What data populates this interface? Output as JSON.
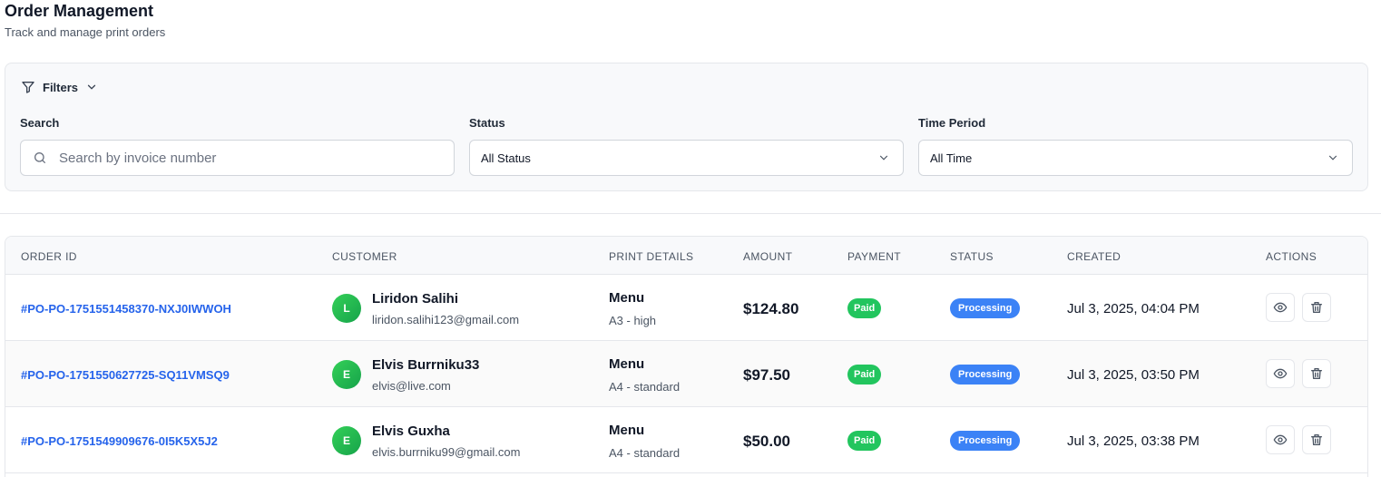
{
  "header": {
    "title": "Order Management",
    "subtitle": "Track and manage print orders"
  },
  "filters": {
    "toggle_label": "Filters",
    "search": {
      "label": "Search",
      "placeholder": "Search by invoice number",
      "value": ""
    },
    "status": {
      "label": "Status",
      "selected": "All Status"
    },
    "time_period": {
      "label": "Time Period",
      "selected": "All Time"
    }
  },
  "table": {
    "columns": [
      "Order ID",
      "Customer",
      "Print Details",
      "Amount",
      "Payment",
      "Status",
      "Created",
      "Actions"
    ],
    "rows": [
      {
        "order_id": "#PO-PO-1751551458370-NXJ0IWWOH",
        "avatar": "L",
        "customer_name": "Liridon Salihi",
        "customer_email": "liridon.salihi123@gmail.com",
        "item": "Menu",
        "spec": "A3 - high",
        "amount": "$124.80",
        "payment": "Paid",
        "status": "Processing",
        "created": "Jul 3, 2025, 04:04 PM"
      },
      {
        "order_id": "#PO-PO-1751550627725-SQ11VMSQ9",
        "avatar": "E",
        "customer_name": "Elvis Burrniku33",
        "customer_email": "elvis@live.com",
        "item": "Menu",
        "spec": "A4 - standard",
        "amount": "$97.50",
        "payment": "Paid",
        "status": "Processing",
        "created": "Jul 3, 2025, 03:50 PM"
      },
      {
        "order_id": "#PO-PO-1751549909676-0I5K5X5J2",
        "avatar": "E",
        "customer_name": "Elvis Guxha",
        "customer_email": "elvis.burrniku99@gmail.com",
        "item": "Menu",
        "spec": "A4 - standard",
        "amount": "$50.00",
        "payment": "Paid",
        "status": "Processing",
        "created": "Jul 3, 2025, 03:38 PM"
      }
    ]
  },
  "colors": {
    "link": "#2563eb",
    "paid": "#22c55e",
    "processing": "#3b82f6",
    "avatar": "#22c55e"
  },
  "icons": [
    "filter-icon",
    "chevron-down-icon",
    "search-icon",
    "eye-icon",
    "trash-icon"
  ]
}
